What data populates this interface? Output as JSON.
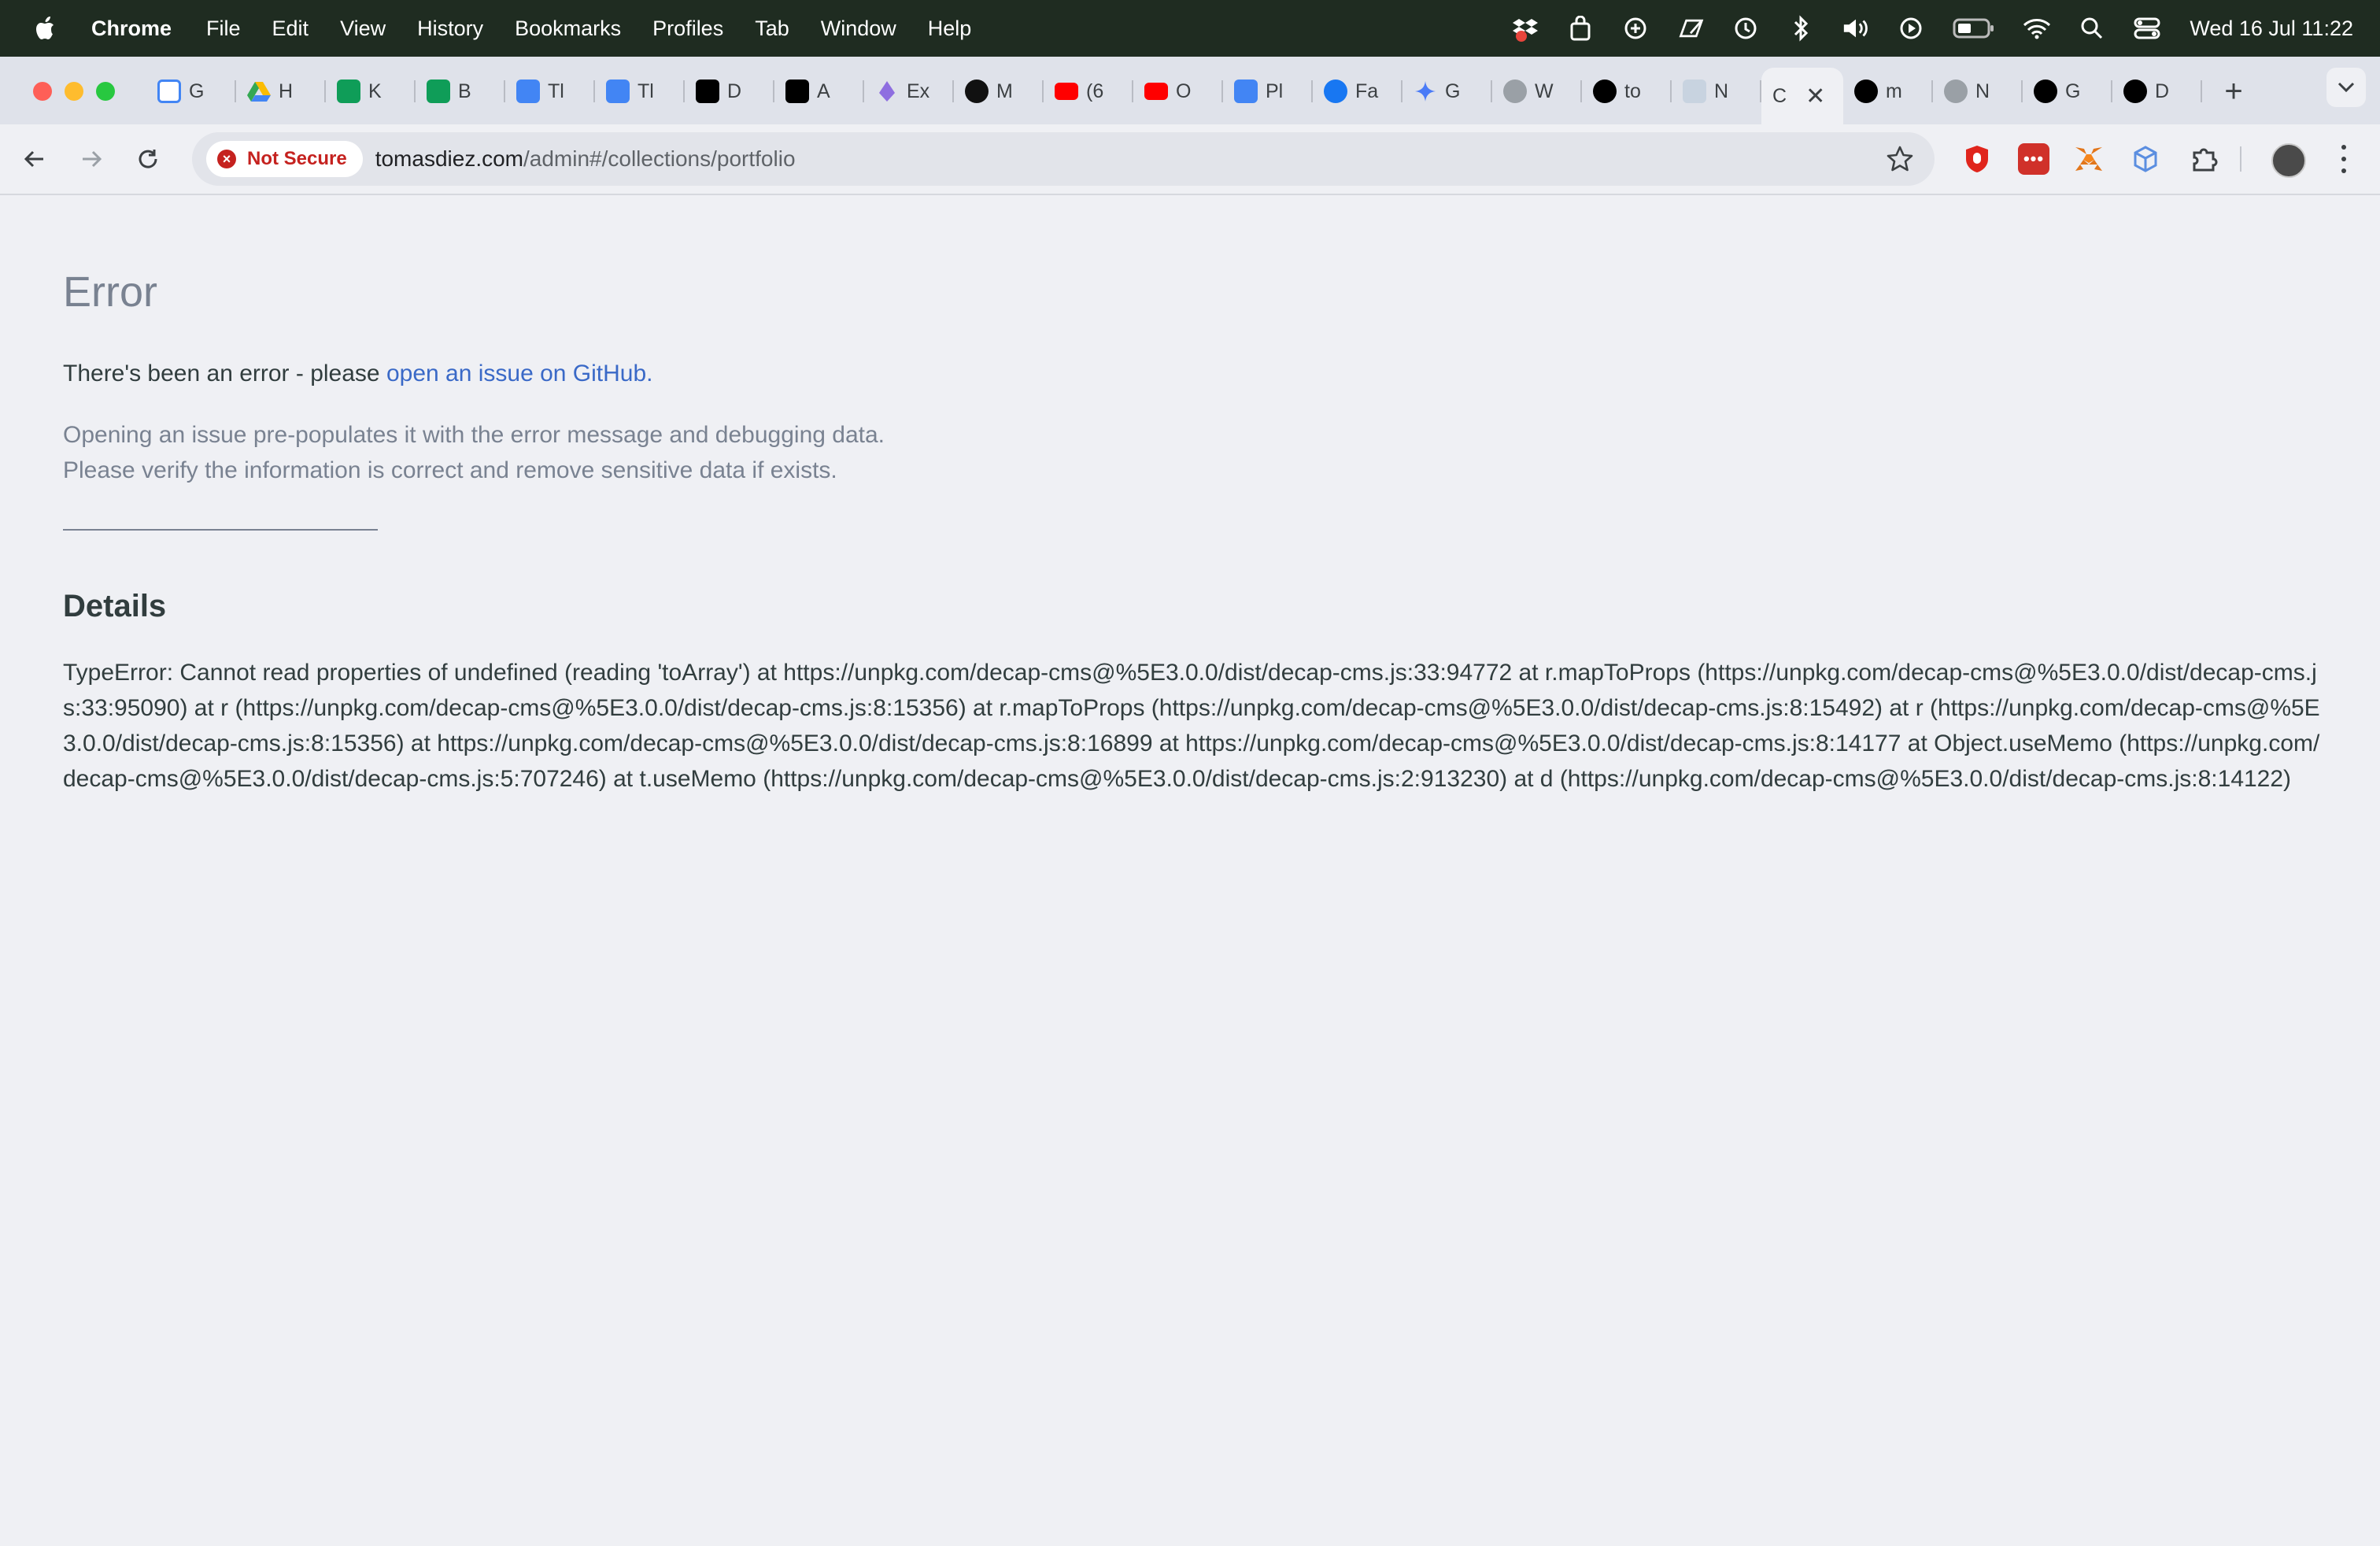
{
  "menubar": {
    "app": "Chrome",
    "items": [
      "File",
      "Edit",
      "View",
      "History",
      "Bookmarks",
      "Profiles",
      "Tab",
      "Window",
      "Help"
    ],
    "clock": "Wed 16 Jul  11:22",
    "status_icons": [
      "dropbox-icon",
      "bag-icon",
      "stage-manager-icon",
      "edit-icon",
      "time-machine-icon",
      "bluetooth-icon",
      "volume-icon",
      "play-icon",
      "battery-icon",
      "wifi-icon",
      "spotlight-icon",
      "control-center-icon"
    ]
  },
  "tabs": [
    {
      "label": "G",
      "icon": "calendar-icon",
      "color": "#4285f4"
    },
    {
      "label": "H",
      "icon": "drive-icon",
      "color": "#34a853"
    },
    {
      "label": "K",
      "icon": "sheets-icon",
      "color": "#0f9d58"
    },
    {
      "label": "B",
      "icon": "sheets-icon",
      "color": "#0f9d58"
    },
    {
      "label": "Tl",
      "icon": "docs-icon",
      "color": "#4285f4"
    },
    {
      "label": "Tl",
      "icon": "docs-icon",
      "color": "#4285f4"
    },
    {
      "label": "D",
      "icon": "medium-icon",
      "color": "#000000"
    },
    {
      "label": "A",
      "icon": "medium-icon",
      "color": "#000000"
    },
    {
      "label": "Ex",
      "icon": "crystal-icon",
      "color": "#8e6ee0"
    },
    {
      "label": "M",
      "icon": "threads-icon",
      "color": "#111111"
    },
    {
      "label": "(6",
      "icon": "youtube-icon",
      "color": "#ff0000"
    },
    {
      "label": "O",
      "icon": "youtube-icon",
      "color": "#ff0000"
    },
    {
      "label": "Pl",
      "icon": "docs-icon",
      "color": "#4285f4"
    },
    {
      "label": "Fa",
      "icon": "facebook-icon",
      "color": "#1877f2"
    },
    {
      "label": "G",
      "icon": "gemini-icon",
      "color": "#4a7bf7"
    },
    {
      "label": "W",
      "icon": "globe-icon",
      "color": "#9aa0a6"
    },
    {
      "label": "to",
      "icon": "vercel-icon",
      "color": "#000000"
    },
    {
      "label": "N",
      "icon": "netlify-icon",
      "color": "#c8d3e0"
    },
    {
      "label": "C",
      "icon": "",
      "color": "",
      "active": true
    },
    {
      "label": "m",
      "icon": "vercel-icon",
      "color": "#000000"
    },
    {
      "label": "N",
      "icon": "globe-icon",
      "color": "#9aa0a6"
    },
    {
      "label": "G",
      "icon": "github-icon",
      "color": "#000000"
    },
    {
      "label": "D",
      "icon": "github-icon",
      "color": "#000000"
    }
  ],
  "omnibox": {
    "security_label": "Not Secure",
    "url_host": "tomasdiez.com",
    "url_path": "/admin#/collections/portfolio"
  },
  "page": {
    "title": "Error",
    "intro_text": "There's been an error - please ",
    "intro_link": "open an issue on GitHub.",
    "note_line1": "Opening an issue pre-populates it with the error message and debugging data.",
    "note_line2": "Please verify the information is correct and remove sensitive data if exists.",
    "details_heading": "Details",
    "stack_trace": "TypeError: Cannot read properties of undefined (reading 'toArray') at https://unpkg.com/decap-cms@%5E3.0.0/dist/decap-cms.js:33:94772 at r.mapToProps (https://unpkg.com/decap-cms@%5E3.0.0/dist/decap-cms.js:33:95090) at r (https://unpkg.com/decap-cms@%5E3.0.0/dist/decap-cms.js:8:15356) at r.mapToProps (https://unpkg.com/decap-cms@%5E3.0.0/dist/decap-cms.js:8:15492) at r (https://unpkg.com/decap-cms@%5E3.0.0/dist/decap-cms.js:8:15356) at https://unpkg.com/decap-cms@%5E3.0.0/dist/decap-cms.js:8:16899 at https://unpkg.com/decap-cms@%5E3.0.0/dist/decap-cms.js:8:14177 at Object.useMemo (https://unpkg.com/decap-cms@%5E3.0.0/dist/decap-cms.js:5:707246) at t.useMemo (https://unpkg.com/decap-cms@%5E3.0.0/dist/decap-cms.js:2:913230) at d (https://unpkg.com/decap-cms@%5E3.0.0/dist/decap-cms.js:8:14122)"
  }
}
